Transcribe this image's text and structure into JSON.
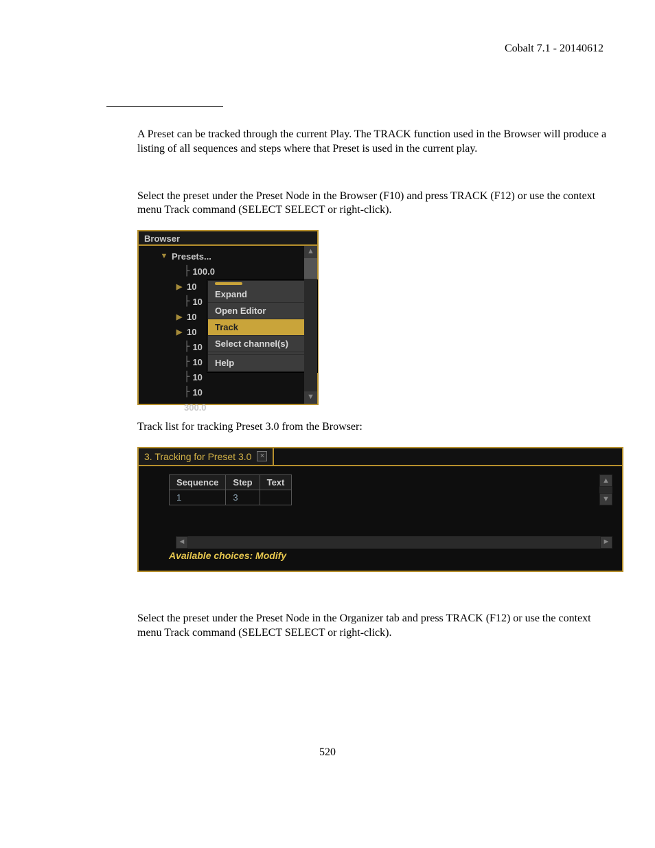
{
  "header": {
    "right": "Cobalt 7.1 - 20140612"
  },
  "paragraphs": {
    "p1": "A Preset can be tracked through the current Play. The TRACK function used in the Browser will produce a listing of all sequences and steps where that Preset is used in the current play.",
    "p2": "Select the preset under the Preset Node in the Browser (F10) and press TRACK (F12) or use the context menu Track command (SELECT SELECT or right-click).",
    "p3": "Track list for tracking Preset 3.0 from the Browser:",
    "p4": "Select the preset under the Preset Node in the Organizer tab and press TRACK (F12) or use the context menu Track command (SELECT SELECT or right-click)."
  },
  "browser": {
    "title": "Browser",
    "root": "Presets...",
    "items": [
      "100.0",
      "10",
      "10",
      "10",
      "10",
      "10",
      "10",
      "10",
      "10",
      "300.0"
    ],
    "menu": {
      "expand": "Expand",
      "open_editor": "Open Editor",
      "track": "Track",
      "select_channels": "Select channel(s)",
      "help": "Help"
    }
  },
  "tracking": {
    "tab_title": "3. Tracking for Preset 3.0",
    "columns": {
      "c1": "Sequence",
      "c2": "Step",
      "c3": "Text"
    },
    "row": {
      "sequence": "1",
      "step": "3",
      "text": ""
    },
    "choices": "Available choices: Modify"
  },
  "footer": {
    "page": "520"
  }
}
